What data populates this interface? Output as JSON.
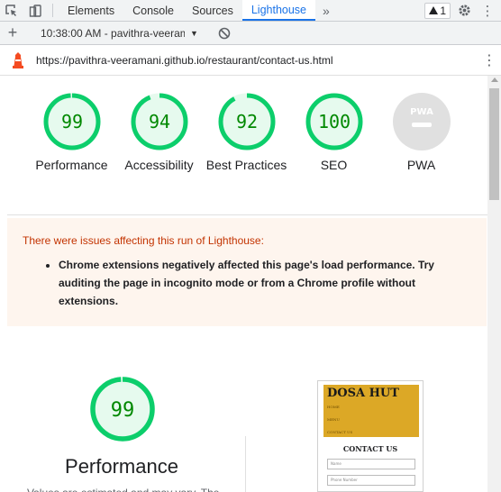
{
  "devtools": {
    "tabs": [
      {
        "label": "Elements",
        "active": false
      },
      {
        "label": "Console",
        "active": false
      },
      {
        "label": "Sources",
        "active": false
      },
      {
        "label": "Lighthouse",
        "active": true
      }
    ],
    "more_tabs_icon": "chevrons-right-icon",
    "warning_count": "1",
    "report_selector": "10:38:00 AM - pavithra-veeram",
    "url": "https://pavithra-veeramani.github.io/restaurant/contact-us.html"
  },
  "scores": [
    {
      "value": "99",
      "label": "Performance",
      "fraction": 0.99
    },
    {
      "value": "94",
      "label": "Accessibility",
      "fraction": 0.94
    },
    {
      "value": "92",
      "label": "Best Practices",
      "fraction": 0.92
    },
    {
      "value": "100",
      "label": "SEO",
      "fraction": 1.0
    },
    {
      "value": "",
      "label": "PWA",
      "fraction": 0
    }
  ],
  "pwa_badge_text": "PWA",
  "warning": {
    "title": "There were issues affecting this run of Lighthouse:",
    "items": [
      "Chrome extensions negatively affected this page's load performance. Try auditing the page in incognito mode or from a Chrome profile without extensions."
    ]
  },
  "performance": {
    "score": "99",
    "title": "Performance",
    "description": "Values are estimated and may vary. The"
  },
  "screenshot": {
    "brand": "DOSA HUT",
    "nav": [
      "HOME",
      "MENU",
      "CONTACT US"
    ],
    "heading": "CONTACT US",
    "fields": [
      "Name",
      "Phone Number"
    ]
  },
  "colors": {
    "pass": "#0cce6b",
    "pass_text": "#008800",
    "pass_fill": "#e6faee",
    "pwa_gray": "#e0e0e0",
    "accent": "#1a73e8",
    "warning_bg": "#fef5ee",
    "warning_title": "#c33300"
  }
}
